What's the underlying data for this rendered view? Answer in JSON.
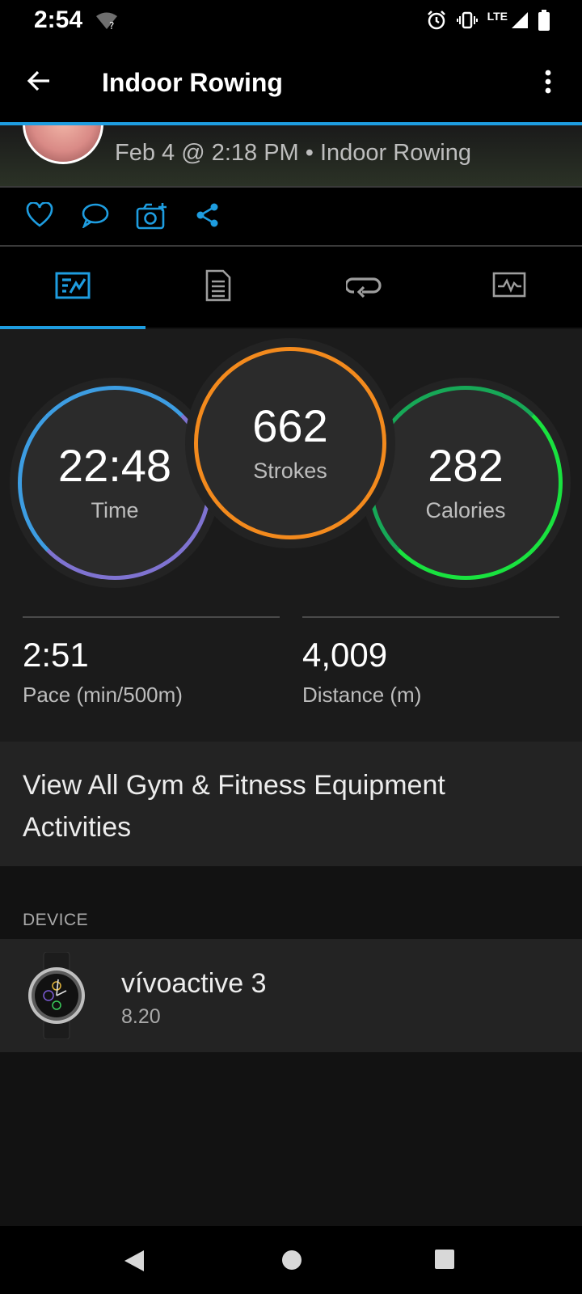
{
  "status_bar": {
    "time": "2:54",
    "network_label": "LTE"
  },
  "app_bar": {
    "title": "Indoor Rowing"
  },
  "activity_header": {
    "subtitle": "Feb 4 @ 2:18 PM • Indoor Rowing"
  },
  "tabs": [
    {
      "icon": "stats-icon",
      "selected": true
    },
    {
      "icon": "details-icon",
      "selected": false
    },
    {
      "icon": "laps-icon",
      "selected": false
    },
    {
      "icon": "chart-icon",
      "selected": false
    }
  ],
  "summary": {
    "time": {
      "value": "22:48",
      "label": "Time"
    },
    "strokes": {
      "value": "662",
      "label": "Strokes"
    },
    "calories": {
      "value": "282",
      "label": "Calories"
    },
    "pace": {
      "value": "2:51",
      "label": "Pace (min/500m)"
    },
    "distance": {
      "value": "4,009",
      "label": "Distance (m)"
    }
  },
  "view_all": {
    "label": "View All Gym & Fitness Equipment Activities"
  },
  "device": {
    "section_label": "DEVICE",
    "name": "vívoactive 3",
    "version": "8.20"
  },
  "colors": {
    "accent": "#1e9de0",
    "time_ring": "#3d9de2",
    "strokes_ring": "#f38a1d",
    "calories_ring": "#19e23f"
  }
}
